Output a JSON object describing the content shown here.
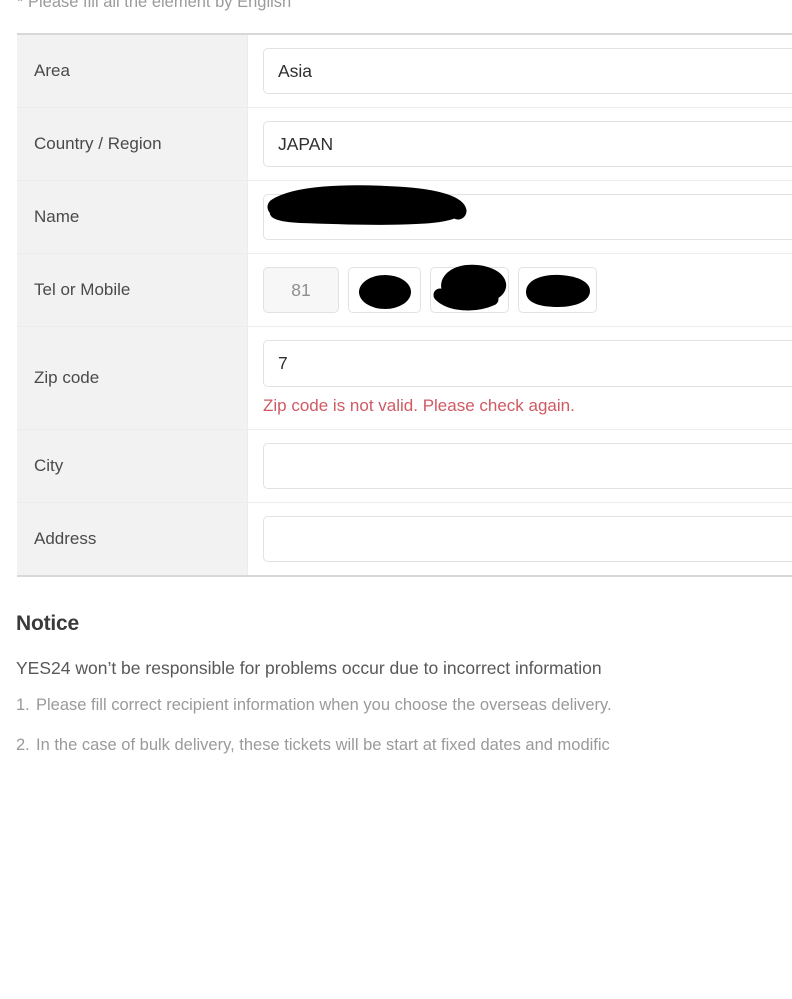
{
  "form": {
    "hint": "* Please fill all the element by English",
    "rows": [
      {
        "label": "Area",
        "type": "text",
        "value": "Asia",
        "placeholder": ""
      },
      {
        "label": "Country / Region",
        "type": "text",
        "value": "JAPAN",
        "placeholder": ""
      },
      {
        "label": "Name",
        "type": "redacted",
        "value": "",
        "placeholder": ""
      },
      {
        "label": "Tel or Mobile",
        "type": "tel",
        "value": "",
        "placeholder": ""
      },
      {
        "label": "Zip code",
        "type": "zip",
        "value": "7",
        "placeholder": ""
      },
      {
        "label": "City",
        "type": "text",
        "value": "",
        "placeholder": ""
      },
      {
        "label": "Address",
        "type": "text",
        "value": "",
        "placeholder": ""
      }
    ],
    "tel": {
      "country_code": "81",
      "part1": "",
      "part2": "",
      "part3": ""
    },
    "zip": {
      "value": "7",
      "error": "Zip code is not valid. Please check again."
    }
  },
  "notice": {
    "title": "Notice",
    "lead": "YES24 won’t be responsible for problems occur due to incorrect information",
    "items": [
      {
        "num": "1.",
        "text": "Please fill correct recipient information when you choose the overseas delivery."
      },
      {
        "num": "2.",
        "text": "In the case of bulk delivery, these tickets will be start at fixed dates and modific"
      }
    ]
  },
  "colors": {
    "label_bg": "#f2f2f2",
    "border": "#e2e2e2",
    "error_red": "#cf5a63",
    "text": "#3c3c3c",
    "muted": "#9a9a9a"
  }
}
